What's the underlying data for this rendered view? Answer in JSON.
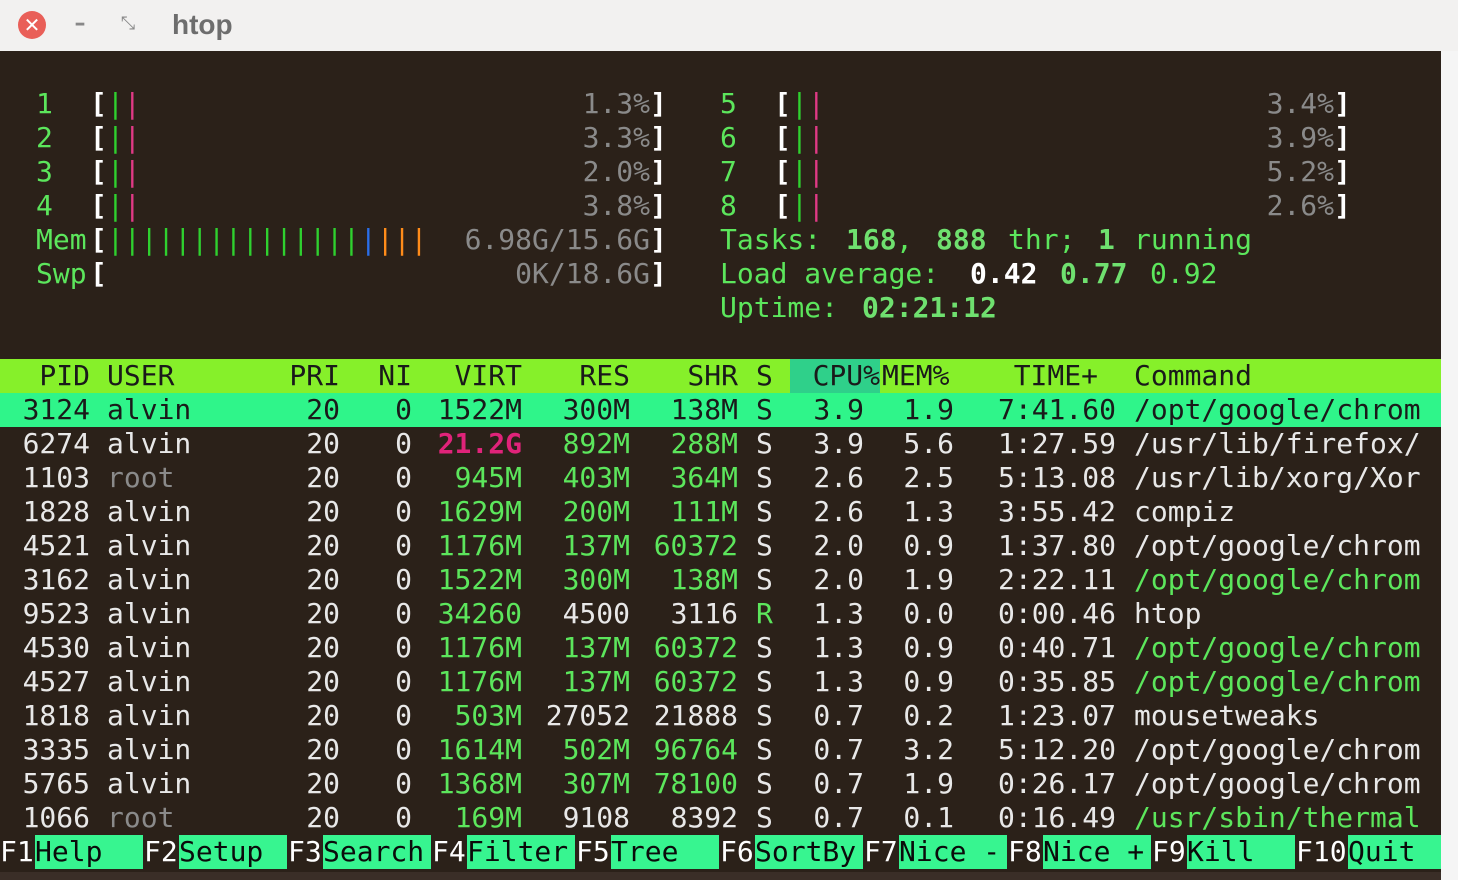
{
  "window": {
    "title": "htop",
    "close_glyph": "✕",
    "minimize_glyph": "–",
    "maximize_glyph": "⤡"
  },
  "cpus": [
    {
      "num": "1",
      "pct": "1.3%"
    },
    {
      "num": "2",
      "pct": "3.3%"
    },
    {
      "num": "3",
      "pct": "2.0%"
    },
    {
      "num": "4",
      "pct": "3.8%"
    },
    {
      "num": "5",
      "pct": "3.4%"
    },
    {
      "num": "6",
      "pct": "3.9%"
    },
    {
      "num": "7",
      "pct": "5.2%"
    },
    {
      "num": "8",
      "pct": "2.6%"
    }
  ],
  "memory": {
    "label": "Mem",
    "value": "6.98G/15.6G",
    "used_fraction": 0.447
  },
  "swap": {
    "label": "Swp",
    "value": "0K/18.6G"
  },
  "tasks": {
    "label": "Tasks:",
    "count": "168",
    "threads": "888",
    "thr_label": "thr;",
    "running": "1",
    "running_label": "running"
  },
  "load": {
    "label": "Load average:",
    "one": "0.42",
    "five": "0.77",
    "fifteen": "0.92"
  },
  "uptime": {
    "label": "Uptime:",
    "value": "02:21:12"
  },
  "columns": {
    "pid": "PID",
    "user": "USER",
    "pri": "PRI",
    "ni": "NI",
    "virt": "VIRT",
    "res": "RES",
    "shr": "SHR",
    "s": "S",
    "cpu": "CPU%",
    "mem": "MEM%",
    "time": "TIME+",
    "command": "Command"
  },
  "processes": [
    {
      "pid": "3124",
      "user": "alvin",
      "pri": "20",
      "ni": "0",
      "virt": "1522M",
      "res": "300M",
      "shr": "138M",
      "s": "S",
      "cpu": "3.9",
      "mem": "1.9",
      "time": "7:41.60",
      "command": "/opt/google/chrom"
    },
    {
      "pid": "6274",
      "user": "alvin",
      "pri": "20",
      "ni": "0",
      "virt": "21.2G",
      "res": "892M",
      "shr": "288M",
      "s": "S",
      "cpu": "3.9",
      "mem": "5.6",
      "time": "1:27.59",
      "command": "/usr/lib/firefox/"
    },
    {
      "pid": "1103",
      "user": "root",
      "pri": "20",
      "ni": "0",
      "virt": "945M",
      "res": "403M",
      "shr": "364M",
      "s": "S",
      "cpu": "2.6",
      "mem": "2.5",
      "time": "5:13.08",
      "command": "/usr/lib/xorg/Xor"
    },
    {
      "pid": "1828",
      "user": "alvin",
      "pri": "20",
      "ni": "0",
      "virt": "1629M",
      "res": "200M",
      "shr": "111M",
      "s": "S",
      "cpu": "2.6",
      "mem": "1.3",
      "time": "3:55.42",
      "command": "compiz"
    },
    {
      "pid": "4521",
      "user": "alvin",
      "pri": "20",
      "ni": "0",
      "virt": "1176M",
      "res": "137M",
      "shr": "60372",
      "s": "S",
      "cpu": "2.0",
      "mem": "0.9",
      "time": "1:37.80",
      "command": "/opt/google/chrom"
    },
    {
      "pid": "3162",
      "user": "alvin",
      "pri": "20",
      "ni": "0",
      "virt": "1522M",
      "res": "300M",
      "shr": "138M",
      "s": "S",
      "cpu": "2.0",
      "mem": "1.9",
      "time": "2:22.11",
      "command": "/opt/google/chrom"
    },
    {
      "pid": "9523",
      "user": "alvin",
      "pri": "20",
      "ni": "0",
      "virt": "34260",
      "res": "4500",
      "shr": "3116",
      "s": "R",
      "cpu": "1.3",
      "mem": "0.0",
      "time": "0:00.46",
      "command": "htop"
    },
    {
      "pid": "4530",
      "user": "alvin",
      "pri": "20",
      "ni": "0",
      "virt": "1176M",
      "res": "137M",
      "shr": "60372",
      "s": "S",
      "cpu": "1.3",
      "mem": "0.9",
      "time": "0:40.71",
      "command": "/opt/google/chrom"
    },
    {
      "pid": "4527",
      "user": "alvin",
      "pri": "20",
      "ni": "0",
      "virt": "1176M",
      "res": "137M",
      "shr": "60372",
      "s": "S",
      "cpu": "1.3",
      "mem": "0.9",
      "time": "0:35.85",
      "command": "/opt/google/chrom"
    },
    {
      "pid": "1818",
      "user": "alvin",
      "pri": "20",
      "ni": "0",
      "virt": "503M",
      "res": "27052",
      "shr": "21888",
      "s": "S",
      "cpu": "0.7",
      "mem": "0.2",
      "time": "1:23.07",
      "command": "mousetweaks"
    },
    {
      "pid": "3335",
      "user": "alvin",
      "pri": "20",
      "ni": "0",
      "virt": "1614M",
      "res": "502M",
      "shr": "96764",
      "s": "S",
      "cpu": "0.7",
      "mem": "3.2",
      "time": "5:12.20",
      "command": "/opt/google/chrom"
    },
    {
      "pid": "5765",
      "user": "alvin",
      "pri": "20",
      "ni": "0",
      "virt": "1368M",
      "res": "307M",
      "shr": "78100",
      "s": "S",
      "cpu": "0.7",
      "mem": "1.9",
      "time": "0:26.17",
      "command": "/opt/google/chrom"
    },
    {
      "pid": "1066",
      "user": "root",
      "pri": "20",
      "ni": "0",
      "virt": "169M",
      "res": "9108",
      "shr": "8392",
      "s": "S",
      "cpu": "0.7",
      "mem": "0.1",
      "time": "0:16.49",
      "command": "/usr/sbin/thermal"
    }
  ],
  "fkeys": [
    {
      "key": "F1",
      "label": "Help  "
    },
    {
      "key": "F2",
      "label": "Setup "
    },
    {
      "key": "F3",
      "label": "Search"
    },
    {
      "key": "F4",
      "label": "Filter"
    },
    {
      "key": "F5",
      "label": "Tree  "
    },
    {
      "key": "F6",
      "label": "SortBy"
    },
    {
      "key": "F7",
      "label": "Nice -"
    },
    {
      "key": "F8",
      "label": "Nice +"
    },
    {
      "key": "F9",
      "label": "Kill  "
    },
    {
      "key": "F10",
      "label": "Quit  "
    }
  ],
  "colors": {
    "terminal_bg": "#2b2119",
    "header_bar": "#86f02a",
    "sorted_column": "#2fd08a",
    "selected_row": "#2ff58a",
    "fkey_label_bg": "#37f590",
    "green_text": "#5ce65c",
    "highlight_pink": "#e0237a"
  }
}
